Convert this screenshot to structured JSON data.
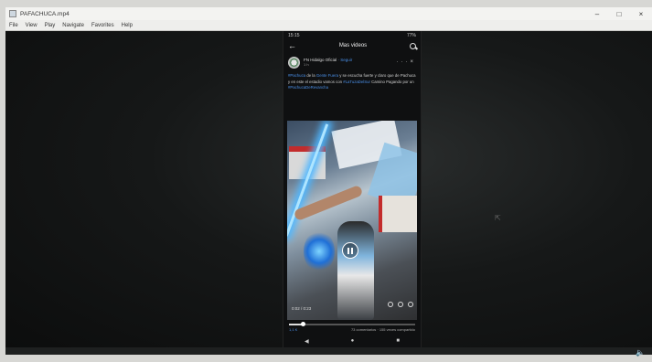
{
  "window": {
    "title": "PAFACHUCA.mp4",
    "minimize": "–",
    "maximize": "□",
    "close": "×"
  },
  "menu": [
    "File",
    "View",
    "Play",
    "Navigate",
    "Favorites",
    "Help"
  ],
  "phone": {
    "status_time": "15:15",
    "status_right": "77%",
    "header_title": "Mas videos",
    "post": {
      "page_name": "FN Hidalgo Oficial",
      "follow_label": "· Seguir",
      "time": "1 h",
      "more": "···",
      "close": "×",
      "text_part1": "de la",
      "text_part2": "y se escucha fuerte y claro que",
      "text_part3": "de Pachuca y en este el estadio vamos con",
      "text_part4": "Camino Pagando por un",
      "link1": "#Pachuca",
      "link2": "Gente Fuera",
      "link3": "#LaTuzaDelSur",
      "link4": "#PachucaDeRevancha"
    },
    "video": {
      "time": "0:02 / 0:23"
    },
    "progress": 0.11,
    "footer_left": "1,1 K",
    "footer_right": "73 comentarios · 155 veces compartido"
  },
  "speaker_icon": "speaker-icon"
}
